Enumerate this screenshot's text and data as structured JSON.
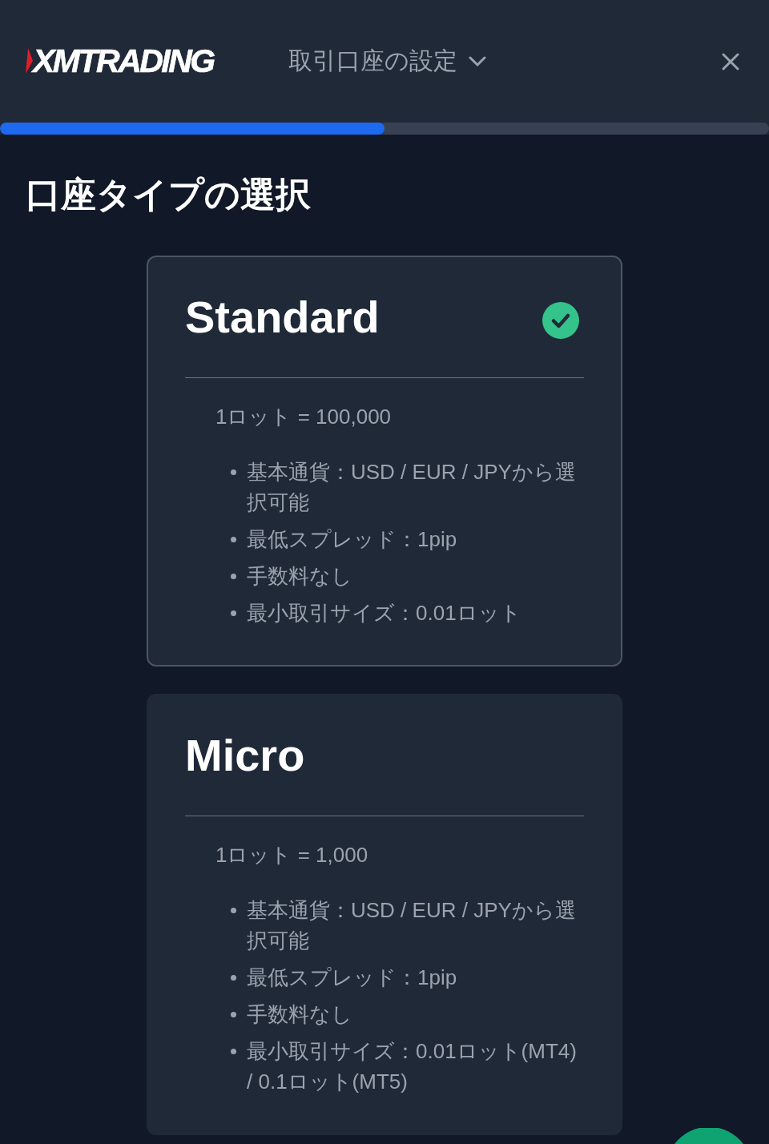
{
  "header": {
    "logo": "XMTRADING",
    "title": "取引口座の設定"
  },
  "progress": {
    "level": 0.5
  },
  "heading": "口座タイプの選択",
  "account_types": [
    {
      "name": "Standard",
      "selected": true,
      "lot_size": "1ロット = 100,000",
      "features": [
        "基本通貨：USD / EUR / JPYから選択可能",
        "最低スプレッド：1pip",
        "手数料なし",
        "最小取引サイズ：0.01ロット"
      ]
    },
    {
      "name": "Micro",
      "selected": false,
      "lot_size": "1ロット = 1,000",
      "features": [
        "基本通貨：USD / EUR / JPYから選択可能",
        "最低スプレッド：1pip",
        "手数料なし",
        "最小取引サイズ：0.01ロット(MT4) / 0.1ロット(MT5)"
      ]
    }
  ]
}
